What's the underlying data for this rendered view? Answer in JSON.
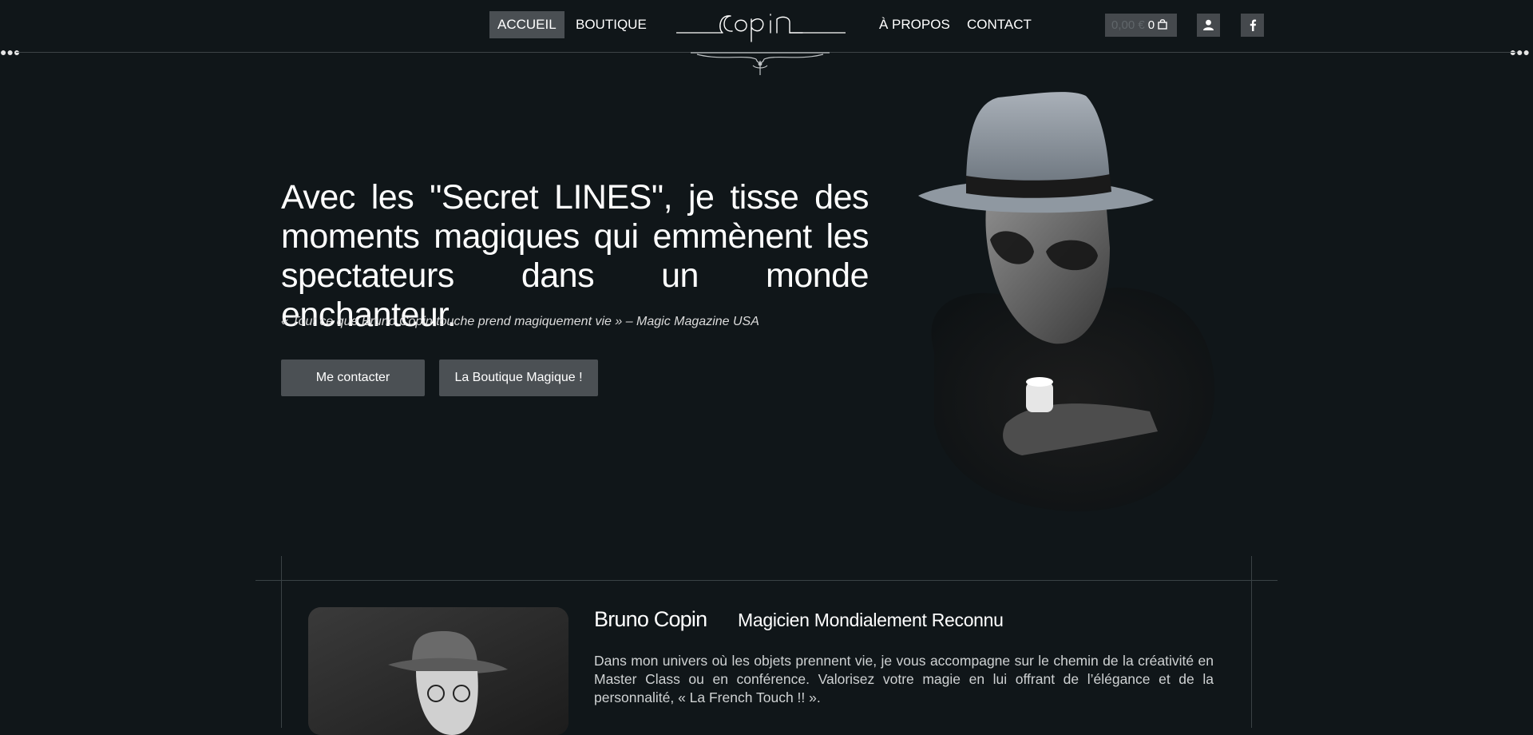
{
  "nav": {
    "home": "ACCUEIL",
    "shop": "BOUTIQUE",
    "about": "À PROPOS",
    "contact": "CONTACT"
  },
  "logo": {
    "text": "copin"
  },
  "cart": {
    "price": "0,00 €",
    "count": "0"
  },
  "icons": {
    "account": "user-icon",
    "social": "facebook-icon",
    "cart": "bag-icon"
  },
  "hero": {
    "title": "Avec les \"Secret LINES\", je tisse des moments magiques qui emmènent les spectateurs dans un monde enchanteur.",
    "quote": "« Tout ce que Bruno Copin touche prend magiquement vie » – Magic Magazine USA",
    "contact_button": "Me contacter",
    "shop_button": "La Boutique Magique !"
  },
  "about": {
    "name": "Bruno Copin",
    "subtitle": "Magicien Mondialement Reconnu",
    "text": "Dans mon univers où les objets prennent vie, je vous accompagne sur le chemin de la créativité en Master Class ou en conférence. Valorisez votre magie en lui offrant de l’élégance et de la personnalité, « La French Touch !! »."
  },
  "colors": {
    "background": "#101619",
    "active_nav": "#4a4f53",
    "button": "#4b5054",
    "divider": "#3d4447"
  }
}
